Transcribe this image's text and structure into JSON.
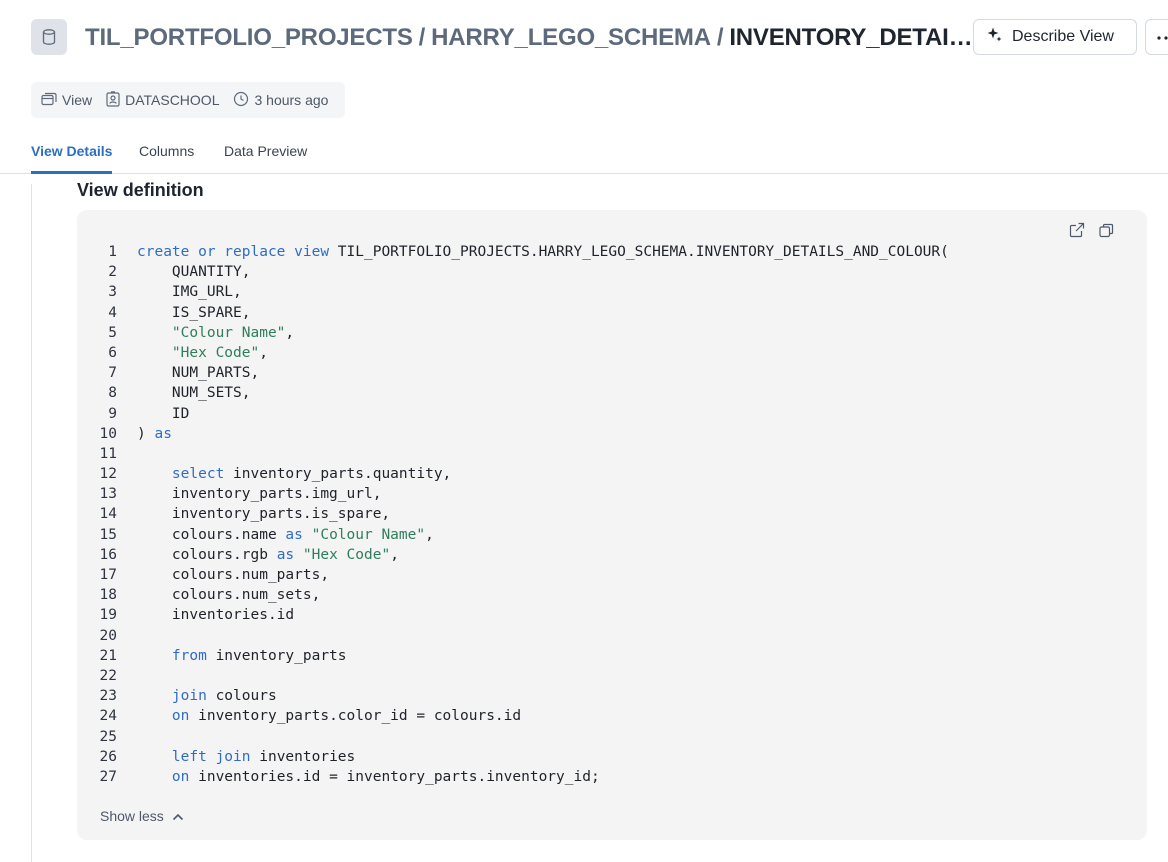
{
  "header": {
    "breadcrumb": [
      "TIL_PORTFOLIO_PROJECTS",
      "HARRY_LEGO_SCHEMA"
    ],
    "separator": "/",
    "current": "INVENTORY_DETAILS_A...",
    "describe_label": "Describe View"
  },
  "meta": {
    "type": "View",
    "owner": "DATASCHOOL",
    "updated": "3 hours ago"
  },
  "tabs": [
    {
      "label": "View Details",
      "active": true
    },
    {
      "label": "Columns",
      "active": false
    },
    {
      "label": "Data Preview",
      "active": false
    }
  ],
  "section": {
    "title": "View definition"
  },
  "code": {
    "lines": [
      [
        [
          "k",
          "create or replace view"
        ],
        [
          "t",
          " TIL_PORTFOLIO_PROJECTS.HARRY_LEGO_SCHEMA.INVENTORY_DETAILS_AND_COLOUR("
        ]
      ],
      [
        [
          "t",
          "    QUANTITY,"
        ]
      ],
      [
        [
          "t",
          "    IMG_URL,"
        ]
      ],
      [
        [
          "t",
          "    IS_SPARE,"
        ]
      ],
      [
        [
          "t",
          "    "
        ],
        [
          "s",
          "\"Colour Name\""
        ],
        [
          "t",
          ","
        ]
      ],
      [
        [
          "t",
          "    "
        ],
        [
          "s",
          "\"Hex Code\""
        ],
        [
          "t",
          ","
        ]
      ],
      [
        [
          "t",
          "    NUM_PARTS,"
        ]
      ],
      [
        [
          "t",
          "    NUM_SETS,"
        ]
      ],
      [
        [
          "t",
          "    ID"
        ]
      ],
      [
        [
          "t",
          ") "
        ],
        [
          "k",
          "as"
        ]
      ],
      [],
      [
        [
          "t",
          "    "
        ],
        [
          "k",
          "select"
        ],
        [
          "t",
          " inventory_parts.quantity,"
        ]
      ],
      [
        [
          "t",
          "    inventory_parts.img_url,"
        ]
      ],
      [
        [
          "t",
          "    inventory_parts.is_spare,"
        ]
      ],
      [
        [
          "t",
          "    colours.name "
        ],
        [
          "k",
          "as"
        ],
        [
          "t",
          " "
        ],
        [
          "s",
          "\"Colour Name\""
        ],
        [
          "t",
          ","
        ]
      ],
      [
        [
          "t",
          "    colours.rgb "
        ],
        [
          "k",
          "as"
        ],
        [
          "t",
          " "
        ],
        [
          "s",
          "\"Hex Code\""
        ],
        [
          "t",
          ","
        ]
      ],
      [
        [
          "t",
          "    colours.num_parts,"
        ]
      ],
      [
        [
          "t",
          "    colours.num_sets,"
        ]
      ],
      [
        [
          "t",
          "    inventories.id"
        ]
      ],
      [],
      [
        [
          "t",
          "    "
        ],
        [
          "k",
          "from"
        ],
        [
          "t",
          " inventory_parts"
        ]
      ],
      [],
      [
        [
          "t",
          "    "
        ],
        [
          "k",
          "join"
        ],
        [
          "t",
          " colours"
        ]
      ],
      [
        [
          "t",
          "    "
        ],
        [
          "k",
          "on"
        ],
        [
          "t",
          " inventory_parts.color_id = colours.id"
        ]
      ],
      [],
      [
        [
          "t",
          "    "
        ],
        [
          "k",
          "left join"
        ],
        [
          "t",
          " inventories"
        ]
      ],
      [
        [
          "t",
          "    "
        ],
        [
          "k",
          "on"
        ],
        [
          "t",
          " inventories.id = inventory_parts.inventory_id;"
        ]
      ]
    ],
    "show_less_label": "Show less"
  },
  "colors": {
    "accent": "#2c6fbe",
    "keyword": "#2f6cc4",
    "string": "#2f7d5b"
  },
  "icons": [
    "database-icon",
    "sparkle-icon",
    "more-icon",
    "view-icon",
    "user-badge-icon",
    "clock-icon",
    "open-external-icon",
    "copy-icon",
    "chevron-up-icon"
  ]
}
